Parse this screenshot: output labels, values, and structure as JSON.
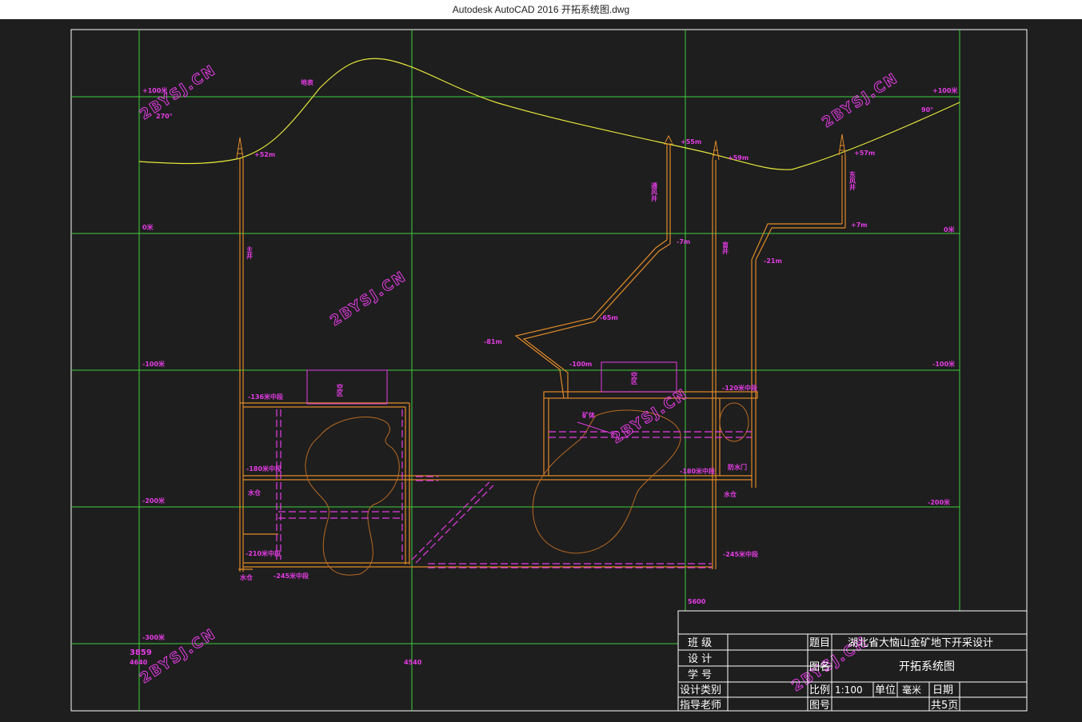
{
  "window": {
    "title": "Autodesk AutoCAD 2016     开拓系统图.dwg"
  },
  "drawing": {
    "levels": {
      "p100_left": "+100米",
      "p100_right": "+100米",
      "zero_left": "0米",
      "zero_right": "0米",
      "m100_left": "-100米",
      "m100_right": "-100米",
      "m200_left": "-200米",
      "m200_right": "-200米",
      "m300_left": "-300米"
    },
    "angles": {
      "left": "270°",
      "right": "90°"
    },
    "surface_label": "地表",
    "shafts": {
      "main": "主井",
      "vent": "通风井",
      "blind": "盲井",
      "east_vent": "东风井"
    },
    "elevations": {
      "main_collar": "+52m",
      "vent_collar": "+55m",
      "blind_collar": "+59m",
      "east_collar": "+57m",
      "e_m7": "-7m",
      "e_m21": "-21m",
      "e_p7": "+7m",
      "e_m65": "-65m",
      "e_m81": "-81m",
      "e_m100": "-100m"
    },
    "labels": {
      "goaf1": "空区",
      "goaf2": "空区",
      "orebody": "矿体",
      "level136": "-136米中段",
      "level180": "-180米中段",
      "level180b": "-180米中段",
      "level120": "-120米中段",
      "level210": "-210米中段",
      "level245": "-245米中段",
      "level245b": "-245米中段",
      "sump1": "水仓",
      "sump2": "水仓",
      "sump3": "水仓",
      "waterdoor": "防水门"
    },
    "coords": {
      "c1": "3859",
      "c2": "4640",
      "c3": "4540",
      "c4": "5600"
    },
    "watermark": "2BYSJ.CN"
  },
  "title_block": {
    "class_label": "班 级",
    "design_label": "设 计",
    "student_label": "学 号",
    "category_label": "设计类别",
    "advisor_label": "指导老师",
    "topic_label": "题目",
    "topic_value": "湖北省大恼山金矿地下开采设计",
    "name_label": "图名",
    "name_value": "开拓系统图",
    "scale_label": "比例",
    "scale_value": "1:100",
    "unit_label": "单位",
    "unit_value": "毫米",
    "date_label": "日期",
    "number_label": "图号",
    "pages_value": "共5页"
  }
}
